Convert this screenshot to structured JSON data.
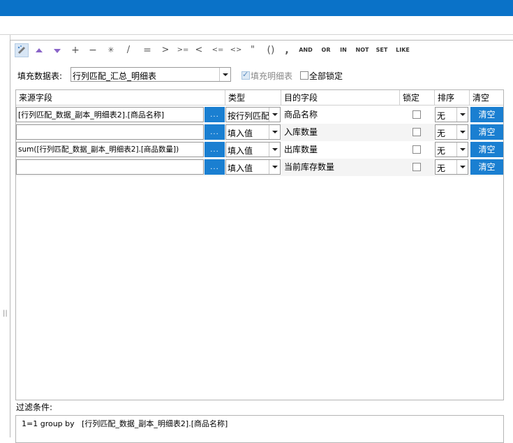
{
  "toolbar": {
    "items": [
      {
        "name": "edit-icon",
        "glyph": ""
      },
      {
        "name": "move-up-icon",
        "glyph": "▲"
      },
      {
        "name": "move-down-icon",
        "glyph": "▼"
      },
      {
        "name": "plus-operator-button",
        "glyph": "+"
      },
      {
        "name": "minus-operator-button",
        "glyph": "−"
      },
      {
        "name": "multiply-operator-button",
        "glyph": "✳"
      },
      {
        "name": "divide-operator-button",
        "glyph": "/"
      },
      {
        "name": "equals-operator-button",
        "glyph": "="
      },
      {
        "name": "greater-than-button",
        "glyph": ">"
      },
      {
        "name": "greater-equal-button",
        "glyph": ">="
      },
      {
        "name": "less-than-button",
        "glyph": "<"
      },
      {
        "name": "less-equal-button",
        "glyph": "<="
      },
      {
        "name": "not-equal-button",
        "glyph": "<>"
      },
      {
        "name": "quote-button",
        "glyph": "\""
      },
      {
        "name": "parentheses-button",
        "glyph": "()"
      },
      {
        "name": "comma-button",
        "glyph": ","
      },
      {
        "name": "and-button",
        "glyph": "AND"
      },
      {
        "name": "or-button",
        "glyph": "OR"
      },
      {
        "name": "in-button",
        "glyph": "IN"
      },
      {
        "name": "not-button",
        "glyph": "NOT"
      },
      {
        "name": "set-button",
        "glyph": "SET"
      },
      {
        "name": "like-button",
        "glyph": "LIKE"
      }
    ]
  },
  "fill_table": {
    "label": "填充数据表:",
    "value": "行列匹配_汇总_明细表",
    "fill_detail_label": "填充明细表",
    "fill_detail_checked": true,
    "lock_all_label": "全部锁定",
    "lock_all_checked": false
  },
  "grid": {
    "headers": {
      "source": "来源字段",
      "type": "类型",
      "target": "目的字段",
      "lock": "锁定",
      "sort": "排序",
      "clear": "清空"
    },
    "rows": [
      {
        "source": "[行列匹配_数据_副本_明细表2].[商品名称]",
        "dots": "...",
        "type": "按行列匹配",
        "target": "商品名称",
        "locked": false,
        "sort": "无",
        "clear": "清空"
      },
      {
        "source": "",
        "dots": "...",
        "type": "填入值",
        "target": "入库数量",
        "locked": false,
        "sort": "无",
        "clear": "清空"
      },
      {
        "source": "sum([行列匹配_数据_副本_明细表2].[商品数量])",
        "dots": "...",
        "type": "填入值",
        "target": "出库数量",
        "locked": false,
        "sort": "无",
        "clear": "清空"
      },
      {
        "source": "",
        "dots": "...",
        "type": "填入值",
        "target": "当前库存数量",
        "locked": false,
        "sort": "无",
        "clear": "清空"
      }
    ]
  },
  "filter": {
    "label": "过滤条件:",
    "value": "1=1 group by   [行列匹配_数据_副本_明细表2].[商品名称]"
  },
  "colors": {
    "titlebar": "#0a72c8",
    "button_blue": "#1a7fd1",
    "arrow_purple": "#8a64c8"
  }
}
